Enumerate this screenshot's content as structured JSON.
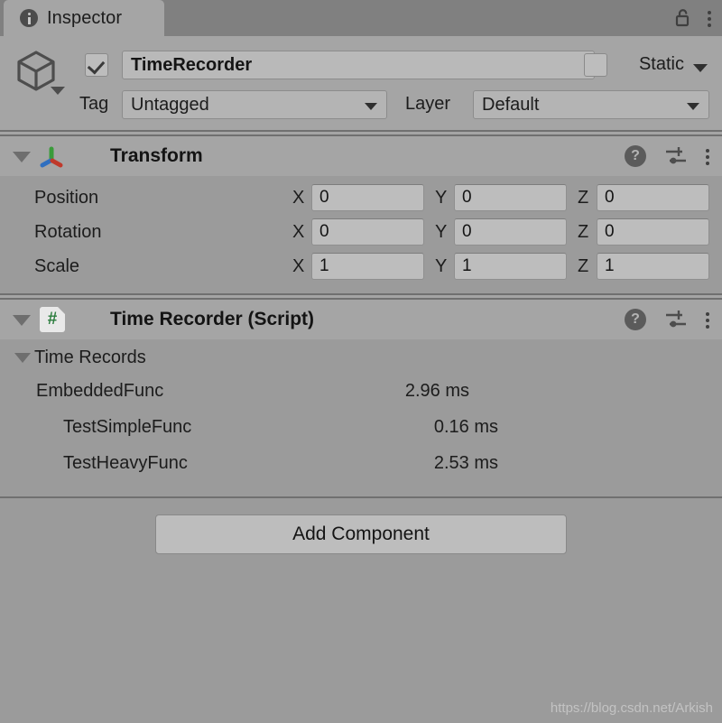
{
  "window": {
    "tab_label": "Inspector",
    "tab_icon": "info-icon",
    "lock_icon": "lock-open-icon",
    "menu_icon": "kebab-menu-icon"
  },
  "gameobject": {
    "icon": "cube-icon",
    "enabled_checkbox": true,
    "name": "TimeRecorder",
    "static_checkbox": false,
    "static_label": "Static",
    "tag_label": "Tag",
    "tag_value": "Untagged",
    "layer_label": "Layer",
    "layer_value": "Default"
  },
  "components": [
    {
      "title": "Transform",
      "icon": "transform-gizmo-icon",
      "expanded": true,
      "help_icon": "help-circle-icon",
      "preset_icon": "preset-sliders-icon",
      "menu_icon": "kebab-menu-icon",
      "rows": [
        {
          "label": "Position",
          "x": "0",
          "y": "0",
          "z": "0"
        },
        {
          "label": "Rotation",
          "x": "0",
          "y": "0",
          "z": "0"
        },
        {
          "label": "Scale",
          "x": "1",
          "y": "1",
          "z": "1"
        }
      ],
      "axis_labels": {
        "x": "X",
        "y": "Y",
        "z": "Z"
      }
    },
    {
      "title": "Time Recorder (Script)",
      "icon": "csharp-script-icon",
      "icon_glyph": "#",
      "expanded": true,
      "help_icon": "help-circle-icon",
      "preset_icon": "preset-sliders-icon",
      "menu_icon": "kebab-menu-icon",
      "records_label": "Time Records",
      "records_expanded": true,
      "records": [
        {
          "name": "EmbeddedFunc",
          "value": "2.96 ms",
          "depth": 0
        },
        {
          "name": "TestSimpleFunc",
          "value": "0.16 ms",
          "depth": 1
        },
        {
          "name": "TestHeavyFunc",
          "value": "2.53 ms",
          "depth": 1
        }
      ]
    }
  ],
  "add_component_label": "Add Component",
  "watermark": "https://blog.csdn.net/Arkish",
  "colors": {
    "panel_bg": "#9b9b9b",
    "header_bg": "#a5a5a5",
    "tabbar_bg": "#808080",
    "field_bg": "#bdbdbd",
    "text": "#1c1c1c",
    "script_green": "#2c7d3e",
    "axis_red": "#c0392b",
    "axis_green": "#3a9b3a",
    "axis_blue": "#2f6fc0"
  }
}
